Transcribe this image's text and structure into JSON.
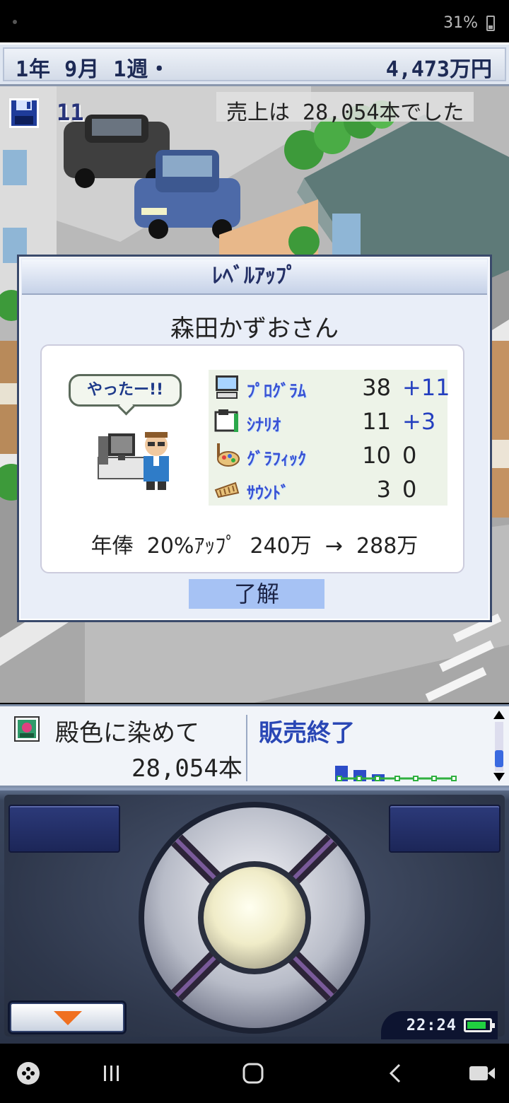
{
  "status_bar": {
    "battery_text": "31%"
  },
  "top_bar": {
    "date": "1年 9月 1週・",
    "money": "4,473万円"
  },
  "scene": {
    "save_count": "11",
    "sales_message": "売上は 28,054本でした"
  },
  "level_up": {
    "title": "ﾚﾍﾞﾙｱｯﾌﾟ",
    "employee_name": "森田かずおさん",
    "speech": "やったー!!",
    "stats": [
      {
        "label": "ﾌﾟﾛｸﾞﾗﾑ",
        "value": "38",
        "increase": "+11",
        "icon": "computer-icon"
      },
      {
        "label": "ｼﾅﾘｵ",
        "value": "11",
        "increase": "+3",
        "icon": "book-icon"
      },
      {
        "label": "ｸﾞﾗﾌｨｯｸ",
        "value": "10",
        "increase": "0",
        "icon": "paint-icon"
      },
      {
        "label": "ｻｳﾝﾄﾞ",
        "value": "3",
        "increase": "0",
        "icon": "music-icon"
      }
    ],
    "salary": "年俸  20%ｱｯﾌﾟ  240万  →  288万",
    "ok_label": "了解"
  },
  "game_panel": {
    "title": "殿色に染めて",
    "sales": "28,054本",
    "status": "販売終了"
  },
  "controller": {
    "time": "22:24"
  },
  "colors": {
    "accent_blue": "#2a47b5",
    "stat_label_blue": "#3a52d4",
    "ok_button": "#a6c2f4",
    "dialog_bg": "#e9eef8"
  }
}
